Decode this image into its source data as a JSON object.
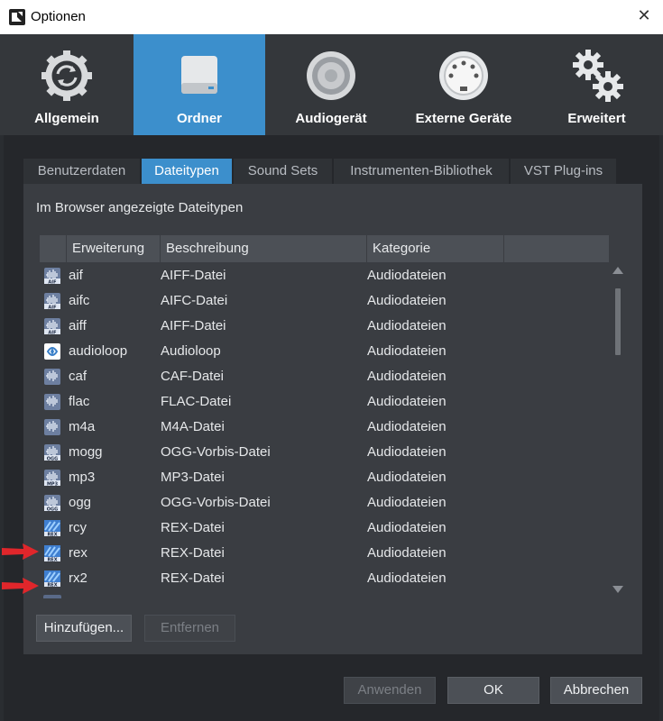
{
  "window": {
    "title": "Optionen",
    "close_glyph": "✕"
  },
  "categories": [
    {
      "label": "Allgemein",
      "icon": "sync-gear-icon",
      "active": false
    },
    {
      "label": "Ordner",
      "icon": "drive-icon",
      "active": true
    },
    {
      "label": "Audiogerät",
      "icon": "speaker-icon",
      "active": false
    },
    {
      "label": "Externe Geräte",
      "icon": "midi-connector-icon",
      "active": false
    },
    {
      "label": "Erweitert",
      "icon": "gears-icon",
      "active": false
    }
  ],
  "tabs": [
    {
      "label": "Benutzerdaten",
      "active": false
    },
    {
      "label": "Dateitypen",
      "active": true
    },
    {
      "label": "Sound Sets",
      "active": false
    },
    {
      "label": "Instrumenten-Bibliothek",
      "active": false
    },
    {
      "label": "VST Plug-ins",
      "active": false
    }
  ],
  "panel": {
    "title": "Im Browser angezeigte Dateitypen"
  },
  "table": {
    "columns": [
      "Erweiterung",
      "Beschreibung",
      "Kategorie"
    ],
    "rows": [
      {
        "ext": "aif",
        "desc": "AIFF-Datei",
        "cat": "Audiodateien",
        "icon": "aif-file-icon",
        "badge": "AIF"
      },
      {
        "ext": "aifc",
        "desc": "AIFC-Datei",
        "cat": "Audiodateien",
        "icon": "aif-file-icon",
        "badge": "AIF"
      },
      {
        "ext": "aiff",
        "desc": "AIFF-Datei",
        "cat": "Audiodateien",
        "icon": "aif-file-icon",
        "badge": "AIF"
      },
      {
        "ext": "audioloop",
        "desc": "Audioloop",
        "cat": "Audiodateien",
        "icon": "audioloop-file-icon",
        "badge": ""
      },
      {
        "ext": "caf",
        "desc": "CAF-Datei",
        "cat": "Audiodateien",
        "icon": "audio-file-icon",
        "badge": ""
      },
      {
        "ext": "flac",
        "desc": "FLAC-Datei",
        "cat": "Audiodateien",
        "icon": "audio-file-icon",
        "badge": ""
      },
      {
        "ext": "m4a",
        "desc": "M4A-Datei",
        "cat": "Audiodateien",
        "icon": "audio-file-icon",
        "badge": ""
      },
      {
        "ext": "mogg",
        "desc": "OGG-Vorbis-Datei",
        "cat": "Audiodateien",
        "icon": "ogg-file-icon",
        "badge": "OGG"
      },
      {
        "ext": "mp3",
        "desc": "MP3-Datei",
        "cat": "Audiodateien",
        "icon": "mp3-file-icon",
        "badge": "MP3"
      },
      {
        "ext": "ogg",
        "desc": "OGG-Vorbis-Datei",
        "cat": "Audiodateien",
        "icon": "ogg-file-icon",
        "badge": "OGG"
      },
      {
        "ext": "rcy",
        "desc": "REX-Datei",
        "cat": "Audiodateien",
        "icon": "rex-file-icon",
        "badge": "REX"
      },
      {
        "ext": "rex",
        "desc": "REX-Datei",
        "cat": "Audiodateien",
        "icon": "rex-file-icon",
        "badge": "REX"
      },
      {
        "ext": "rx2",
        "desc": "REX-Datei",
        "cat": "Audiodateien",
        "icon": "rex-file-icon",
        "badge": "REX"
      }
    ]
  },
  "buttons": {
    "add": "Hinzufügen...",
    "remove": "Entfernen",
    "apply": "Anwenden",
    "ok": "OK",
    "cancel": "Abbrechen"
  },
  "colors": {
    "accent": "#3c8fcc",
    "annotation_arrow": "#e0262b"
  }
}
